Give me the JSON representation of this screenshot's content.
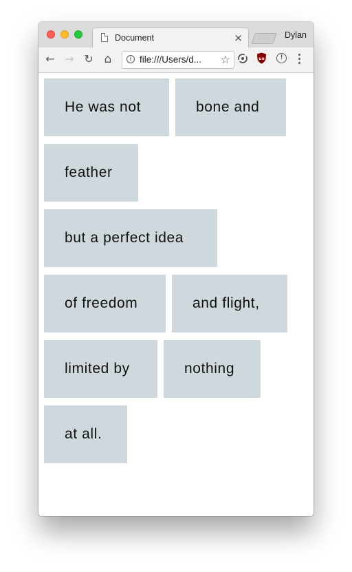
{
  "tab": {
    "title": "Document",
    "close_label": "×"
  },
  "profile": {
    "name": "Dylan"
  },
  "toolbar": {
    "back_icon": "←",
    "forward_icon": "→",
    "reload_icon": "↻",
    "home_icon": "⌂",
    "url": "file:///Users/d...",
    "bookmark_icon": "☆",
    "info_icon": "i",
    "alert_icon": "!"
  },
  "content": {
    "boxes": [
      "He was not",
      "bone and",
      "feather",
      "but a perfect idea",
      "of freedom",
      "and flight,",
      "limited by",
      "nothing",
      "at all."
    ]
  },
  "colors": {
    "box_background": "#cfd8dc",
    "traffic_red": "#fc5f57",
    "traffic_yellow": "#fdbc2e",
    "traffic_green": "#28c840",
    "ublock_red": "#800000"
  }
}
